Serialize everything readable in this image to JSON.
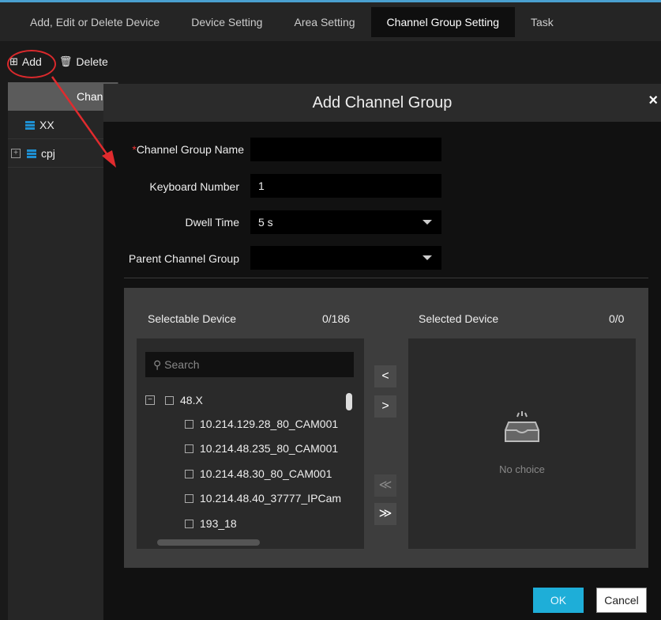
{
  "tabs": [
    {
      "label": "Add, Edit or Delete Device"
    },
    {
      "label": "Device Setting"
    },
    {
      "label": "Area Setting"
    },
    {
      "label": "Channel Group Setting"
    },
    {
      "label": "Task"
    }
  ],
  "active_tab": "Channel Group Setting",
  "toolbar": {
    "add_label": "Add",
    "delete_label": "Delete"
  },
  "left_panel": {
    "header": "Chan",
    "items": [
      {
        "label": "XX",
        "icon": "grid-icon"
      },
      {
        "label": "cpj",
        "icon": "grid-icon",
        "expandable": true
      }
    ]
  },
  "dialog": {
    "title": "Add Channel Group",
    "close_symbol": "×",
    "fields": {
      "name_label": "Channel Group Name",
      "name_value": "",
      "required_mark": "*",
      "keyboard_label": "Keyboard Number",
      "keyboard_value": "1",
      "dwell_label": "Dwell Time",
      "dwell_value": "5 s",
      "parent_label": "Parent Channel Group",
      "parent_value": ""
    },
    "transfer": {
      "left_title": "Selectable Device",
      "left_count": "0/186",
      "right_title": "Selected Device",
      "right_count": "0/0",
      "search_placeholder": "Search",
      "tree": [
        {
          "label": "48.X",
          "group": true
        },
        {
          "label": "10.214.129.28_80_CAM001"
        },
        {
          "label": "10.214.48.235_80_CAM001"
        },
        {
          "label": "10.214.48.30_80_CAM001"
        },
        {
          "label": "10.214.48.40_37777_IPCam"
        },
        {
          "label": "193_18"
        }
      ],
      "buttons": {
        "move_left": "<",
        "move_right": ">",
        "move_all_left": "≪",
        "move_all_right": "≫"
      },
      "empty_text": "No choice"
    },
    "ok_label": "OK",
    "cancel_label": "Cancel"
  },
  "colors": {
    "accent": "#1eaed8",
    "annotation": "#d9292c",
    "icon_blue": "#1e8fd1"
  }
}
